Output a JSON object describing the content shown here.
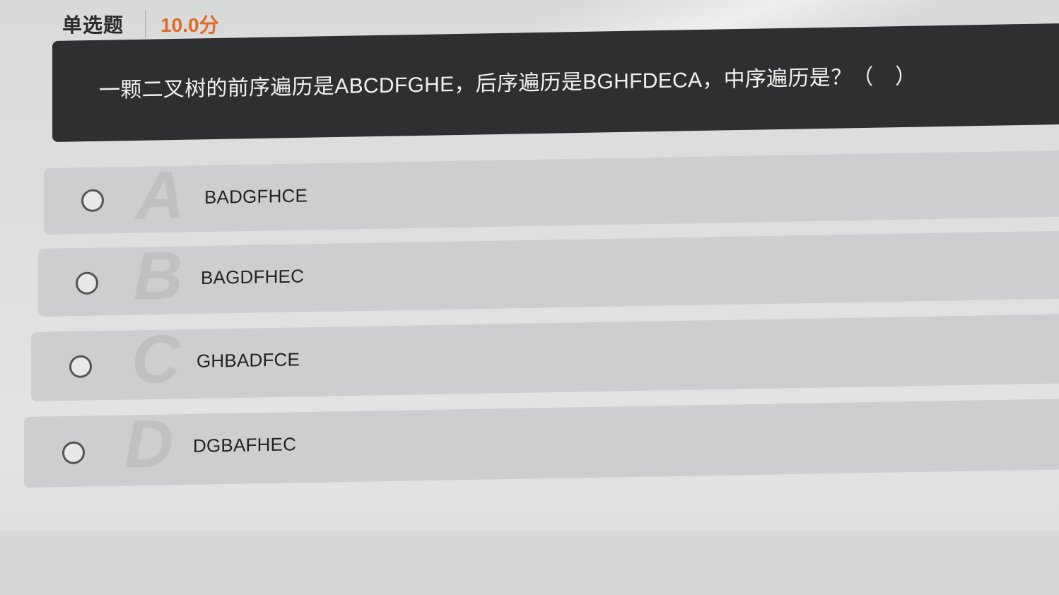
{
  "header": {
    "question_type": "单选题",
    "score": "10.0分"
  },
  "question": {
    "text": "一颗二叉树的前序遍历是ABCDFGHE，后序遍历是BGHFDECA，中序遍历是？（　）"
  },
  "options": [
    {
      "letter": "A",
      "text": "BADGFHCE"
    },
    {
      "letter": "B",
      "text": "BAGDFHEC"
    },
    {
      "letter": "C",
      "text": "GHBADFCE"
    },
    {
      "letter": "D",
      "text": "DGBAFHEC"
    }
  ]
}
